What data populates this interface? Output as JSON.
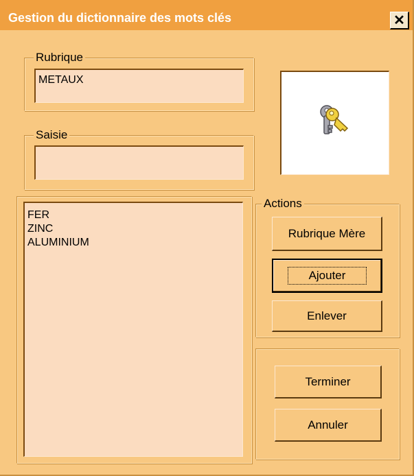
{
  "window": {
    "title": "Gestion du dictionnaire des mots clés",
    "close_glyph": "✕"
  },
  "rubrique": {
    "label": "Rubrique",
    "value": "METAUX"
  },
  "saisie": {
    "label": "Saisie",
    "value": ""
  },
  "image": {
    "icon": "keys-icon"
  },
  "keywords": {
    "items": [
      "FER",
      "ZINC",
      "ALUMINIUM"
    ]
  },
  "actions": {
    "label": "Actions",
    "parent_label": "Rubrique Mère",
    "add_label": "Ajouter",
    "remove_label": "Enlever"
  },
  "footer": {
    "finish_label": "Terminer",
    "cancel_label": "Annuler"
  },
  "colors": {
    "titlebar": "#f0a040",
    "background": "#f8c881",
    "field": "#fbdcc0"
  }
}
